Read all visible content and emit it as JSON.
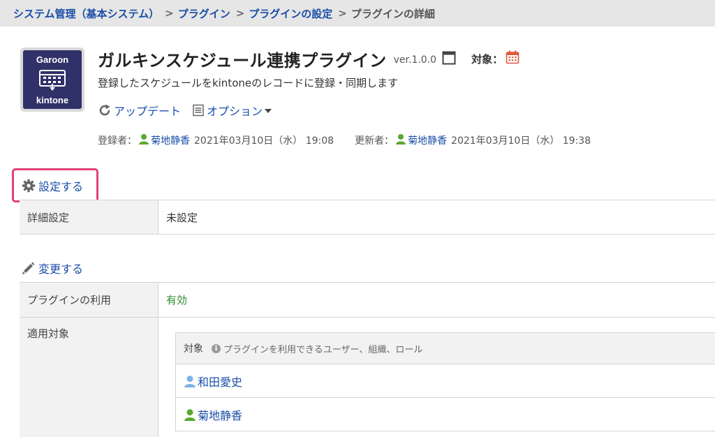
{
  "breadcrumb": {
    "items": [
      "システム管理（基本システム）",
      "プラグイン",
      "プラグインの設定"
    ],
    "current": "プラグインの詳細",
    "separator": ">"
  },
  "plugin": {
    "icon": {
      "top_text": "Garoon",
      "bottom_text": "kintone",
      "icon_name": "garoon-kintone-icon"
    },
    "title": "ガルキンスケジュール連携プラグイン",
    "version": "ver.1.0.0",
    "target_label": "対象：",
    "description": "登録したスケジュールをkintoneのレコードに登録・同期します",
    "actions": {
      "update": "アップデート",
      "options": "オプション"
    },
    "registered": {
      "label": "登録者：",
      "user": "菊地静香",
      "date": "2021年03月10日（水） 19:08"
    },
    "updated": {
      "label": "更新者：",
      "user": "菊地静香",
      "date": "2021年03月10日（水） 19:38"
    }
  },
  "settings": {
    "link": "設定する",
    "detail_label": "詳細設定",
    "detail_value": "未設定"
  },
  "usage": {
    "change_link": "変更する",
    "plugin_use_label": "プラグインの利用",
    "plugin_use_value": "有効",
    "target_label": "適用対象",
    "target_table": {
      "header": "対象",
      "hint": "プラグインを利用できるユーザー、組織、ロール",
      "rows": [
        "和田愛史",
        "菊地静香"
      ]
    }
  },
  "colors": {
    "link": "#1a4ea8",
    "highlight_border": "#e0407a",
    "enabled": "#2e8b2e",
    "icon_bg": "#2f3168"
  }
}
